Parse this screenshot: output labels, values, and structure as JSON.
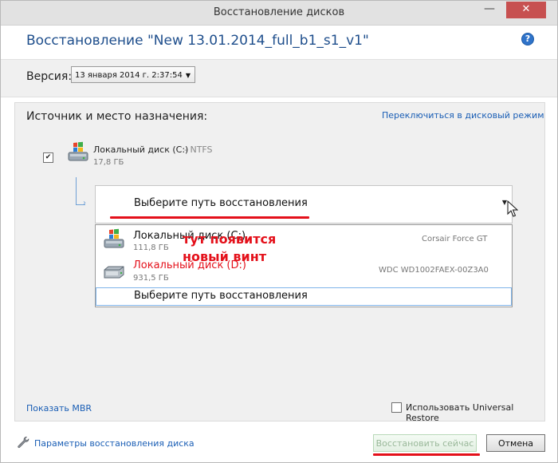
{
  "window": {
    "title": "Восстановление дисков",
    "minimize_glyph": "—",
    "close_glyph": "✕"
  },
  "header": {
    "title": "Восстановление \"New 13.01.2014_full_b1_s1_v1\"",
    "help_glyph": "?"
  },
  "version": {
    "label": "Версия:",
    "selected": "13 января 2014 г. 2:37:54"
  },
  "source": {
    "label": "Источник и место назначения:",
    "switch_link": "Переключиться в дисковый режим",
    "disk": {
      "name": "Локальный диск (C:)",
      "fs": "- NTFS",
      "size": "17,8 ГБ",
      "checked": true
    }
  },
  "target": {
    "placeholder": "Выберите путь восстановления"
  },
  "dropdown": {
    "items": [
      {
        "name": "Локальный диск (C:)",
        "size": "111,8 ГБ",
        "model": "Corsair Force GT",
        "icon": "windows-drive-icon"
      },
      {
        "name": "Локальный диск (D:)",
        "size": "931,5 ГБ",
        "model": "WDC WD1002FAEX-00Z3A0",
        "icon": "hard-drive-icon"
      }
    ],
    "last_item": "Выберите путь восстановления"
  },
  "annotation": {
    "line1": "тут появится",
    "line2": "новый винт"
  },
  "options": {
    "mbr_link": "Показать MBR",
    "universal_restore": "Использовать Universal Restore"
  },
  "footer": {
    "params_link": "Параметры восстановления диска",
    "restore_button": "Восстановить сейчас",
    "cancel_button": "Отмена"
  },
  "colors": {
    "accent_link": "#1a5eb5",
    "title_blue": "#1e4e8c",
    "annotation_red": "#e4101a"
  }
}
